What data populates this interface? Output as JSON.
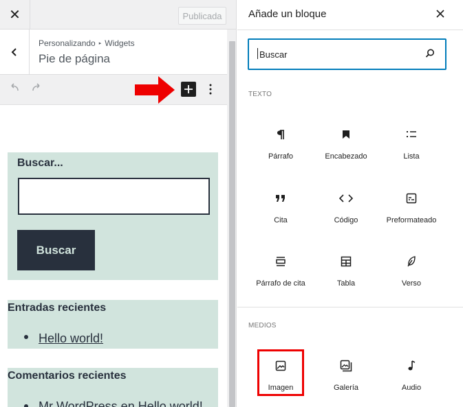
{
  "left": {
    "close_icon": "close-icon",
    "publish_label": "Publicada",
    "breadcrumb": {
      "part1": "Personalizando",
      "separator": "▸",
      "part2": "Widgets"
    },
    "title": "Pie de página",
    "undo_icon": "undo-icon",
    "redo_icon": "redo-icon",
    "add_block_icon": "plus-icon",
    "options_icon": "more-vertical-icon"
  },
  "widgets": {
    "search": {
      "label": "Buscar...",
      "input_value": "",
      "button_label": "Buscar"
    },
    "recent_posts": {
      "title": "Entradas recientes",
      "items": [
        "Hello world!"
      ]
    },
    "recent_comments": {
      "title": "Comentarios recientes",
      "items": [
        "Mr WordPress en Hello world!"
      ]
    }
  },
  "inserter": {
    "title": "Añade un bloque",
    "close_icon": "close-icon",
    "search_placeholder": "Buscar",
    "sections": [
      {
        "label": "Texto",
        "blocks": [
          {
            "label": "Párrafo",
            "icon": "paragraph-icon"
          },
          {
            "label": "Encabezado",
            "icon": "bookmark-icon"
          },
          {
            "label": "Lista",
            "icon": "list-icon"
          },
          {
            "label": "Cita",
            "icon": "quote-icon"
          },
          {
            "label": "Código",
            "icon": "code-icon"
          },
          {
            "label": "Preformateado",
            "icon": "preformatted-icon"
          },
          {
            "label": "Párrafo de cita",
            "icon": "pullquote-icon"
          },
          {
            "label": "Tabla",
            "icon": "table-icon"
          },
          {
            "label": "Verso",
            "icon": "feather-icon"
          }
        ]
      },
      {
        "label": "Medios",
        "blocks": [
          {
            "label": "Imagen",
            "icon": "image-icon"
          },
          {
            "label": "Galería",
            "icon": "gallery-icon"
          },
          {
            "label": "Audio",
            "icon": "audio-icon"
          }
        ]
      }
    ]
  },
  "colors": {
    "widget_background": "#d1e4dd",
    "widget_text": "#28303d",
    "focus_blue": "#007cba",
    "highlight_red": "#ee0000"
  }
}
